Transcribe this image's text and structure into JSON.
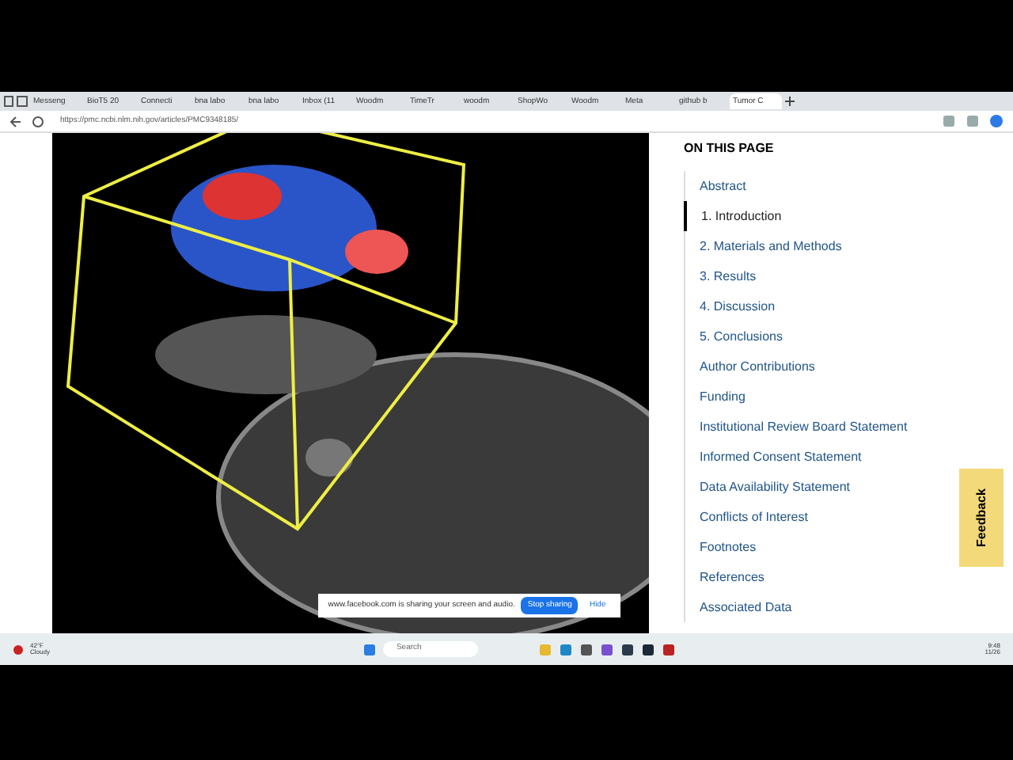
{
  "browser": {
    "tabs": [
      {
        "label": "Messeng",
        "selected": false
      },
      {
        "label": "BioT5 20",
        "selected": false
      },
      {
        "label": "Connecti",
        "selected": false
      },
      {
        "label": "bna labo",
        "selected": false
      },
      {
        "label": "bna labo",
        "selected": false
      },
      {
        "label": "Inbox (11",
        "selected": false
      },
      {
        "label": "Woodm",
        "selected": false
      },
      {
        "label": "TimeTr",
        "selected": false
      },
      {
        "label": "woodm",
        "selected": false
      },
      {
        "label": "ShopWo",
        "selected": false
      },
      {
        "label": "Woodm",
        "selected": false
      },
      {
        "label": "Meta",
        "selected": false
      },
      {
        "label": "github b",
        "selected": false
      },
      {
        "label": "Tumor C",
        "selected": true
      }
    ],
    "url": "https://pmc.ncbi.nlm.nih.gov/articles/PMC9348185/"
  },
  "sidebar": {
    "heading": "ON THIS PAGE",
    "items": [
      {
        "label": "Abstract",
        "selected": false
      },
      {
        "label": "1. Introduction",
        "selected": true
      },
      {
        "label": "2. Materials and Methods",
        "selected": false
      },
      {
        "label": "3. Results",
        "selected": false
      },
      {
        "label": "4. Discussion",
        "selected": false
      },
      {
        "label": "5. Conclusions",
        "selected": false
      },
      {
        "label": "Author Contributions",
        "selected": false
      },
      {
        "label": "Funding",
        "selected": false
      },
      {
        "label": "Institutional Review Board Statement",
        "selected": false
      },
      {
        "label": "Informed Consent Statement",
        "selected": false
      },
      {
        "label": "Data Availability Statement",
        "selected": false
      },
      {
        "label": "Conflicts of Interest",
        "selected": false
      },
      {
        "label": "Footnotes",
        "selected": false
      },
      {
        "label": "References",
        "selected": false
      },
      {
        "label": "Associated Data",
        "selected": false
      }
    ]
  },
  "feedback": "Feedback",
  "share_banner": {
    "message": "www.facebook.com is sharing your screen and audio.",
    "stop": "Stop sharing",
    "hide": "Hide"
  },
  "taskbar": {
    "temperature": "42°F",
    "weather": "Cloudy",
    "search_placeholder": "Search",
    "time": "9:48",
    "date": "11/26"
  }
}
